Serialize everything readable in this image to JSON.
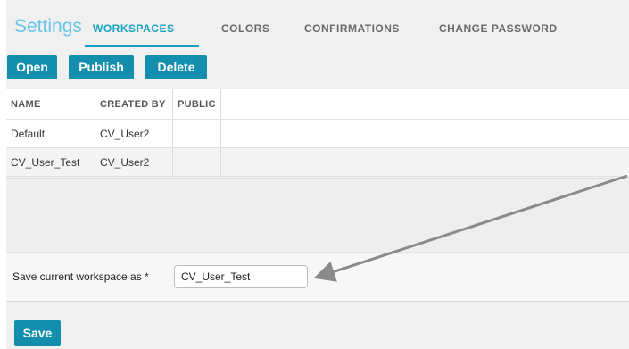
{
  "header": {
    "title": "Settings",
    "tabs": [
      {
        "label": "WORKSPACES",
        "active": true
      },
      {
        "label": "COLORS",
        "active": false
      },
      {
        "label": "CONFIRMATIONS",
        "active": false
      },
      {
        "label": "CHANGE PASSWORD",
        "active": false
      }
    ]
  },
  "toolbar": {
    "open_label": "Open",
    "publish_label": "Publish",
    "delete_label": "Delete"
  },
  "table": {
    "columns": [
      "NAME",
      "CREATED BY",
      "PUBLIC"
    ],
    "rows": [
      {
        "name": "Default",
        "created_by": "CV_User2",
        "public": ""
      },
      {
        "name": "CV_User_Test",
        "created_by": "CV_User2",
        "public": ""
      }
    ]
  },
  "save_as": {
    "label": "Save current workspace as *",
    "value": "CV_User_Test"
  },
  "footer": {
    "save_label": "Save"
  },
  "colors": {
    "accent": "#17a3c4",
    "button": "#138ead",
    "title": "#69c6e6",
    "annotation_arrow": "#8a8a8a"
  }
}
